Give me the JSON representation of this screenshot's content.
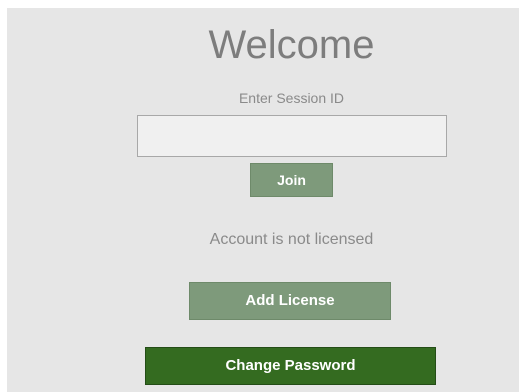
{
  "welcome": {
    "title": "Welcome",
    "prompt": "Enter Session ID",
    "session_input": {
      "value": "",
      "placeholder": ""
    },
    "join_label": "Join",
    "status_text": "Account is not licensed",
    "add_license_label": "Add License",
    "change_password_label": "Change Password"
  },
  "colors": {
    "panel_background": "#e6e6e6",
    "muted_text": "#8a8a8a",
    "secondary_button": "#7e9a7b",
    "primary_button": "#346b20"
  }
}
